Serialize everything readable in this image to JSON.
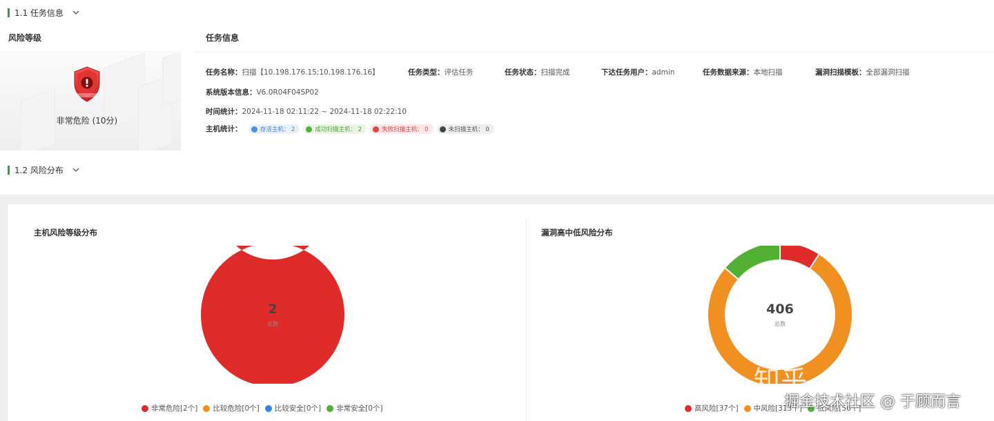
{
  "section1": {
    "title": "1.1 任务信息"
  },
  "risk_level": {
    "title": "风险等级",
    "label": "非常危险 (10分)",
    "icon": "shield-warning-icon",
    "color": "#e02b2b"
  },
  "task_info": {
    "title": "任务信息",
    "name_label": "任务名称：",
    "name_value": "扫描【10.198.176.15;10.198.176.16】",
    "type_label": "任务类型：",
    "type_value": "评估任务",
    "status_label": "任务状态：",
    "status_value": "扫描完成",
    "user_label": "下达任务用户：",
    "user_value": "admin",
    "source_label": "任务数据来源：",
    "source_value": "本地扫描",
    "template_label": "漏洞扫描模板：",
    "template_value": "全部漏洞扫描",
    "version_label": "系统版本信息：",
    "version_value": "V6.0R04F04SP02",
    "time_label": "时间统计：",
    "time_value": "2024-11-18 02:11:22 ~ 2024-11-18 02:22:10",
    "hosts_label": "主机统计：",
    "host_tags": [
      {
        "text": "存活主机：  2",
        "color": "#4a90e2",
        "bg": "#e8f1fc",
        "fg": "#4a7fc1"
      },
      {
        "text": "成功扫描主机：  2",
        "color": "#52b033",
        "bg": "#eaf6e4",
        "fg": "#52a033"
      },
      {
        "text": "失败扫描主机：  0",
        "color": "#e04848",
        "bg": "#fce8e8",
        "fg": "#d04848"
      },
      {
        "text": "未扫描主机：  0",
        "color": "#444444",
        "bg": "#eeeeee",
        "fg": "#555555"
      }
    ]
  },
  "section2": {
    "title": "1.2 风险分布"
  },
  "host_risk_chart": {
    "title": "主机风险等级分布",
    "center_value": "2",
    "center_label": "总数",
    "legend": [
      {
        "text": "非常危险[2个]",
        "color": "#e02b2b"
      },
      {
        "text": "比较危险[0个]",
        "color": "#f09020"
      },
      {
        "text": "比较安全[0个]",
        "color": "#2b8ae0"
      },
      {
        "text": "非常安全[0个]",
        "color": "#52b033"
      }
    ]
  },
  "vuln_risk_chart": {
    "title": "漏洞高中低风险分布",
    "center_value": "406",
    "center_label": "总数",
    "legend": [
      {
        "text": "高风险[37个]",
        "color": "#e02b2b"
      },
      {
        "text": "中风险[313个]",
        "color": "#f09020"
      },
      {
        "text": "低风险[56个]",
        "color": "#52b033"
      }
    ]
  },
  "chart_data": [
    {
      "type": "pie",
      "title": "主机风险等级分布",
      "categories": [
        "非常危险",
        "比较危险",
        "比较安全",
        "非常安全"
      ],
      "values": [
        2,
        0,
        0,
        0
      ],
      "colors": [
        "#e02b2b",
        "#f09020",
        "#2b8ae0",
        "#52b033"
      ],
      "legend": "bottom"
    },
    {
      "type": "pie",
      "title": "漏洞高中低风险分布",
      "categories": [
        "高风险",
        "中风险",
        "低风险"
      ],
      "values": [
        37,
        313,
        56
      ],
      "colors": [
        "#e02b2b",
        "#f09020",
        "#52b033"
      ],
      "legend": "bottom"
    }
  ],
  "watermark": {
    "line1": "知乎 @于顾而言",
    "line2": "掘金技术社区 @ 于顾而言"
  }
}
